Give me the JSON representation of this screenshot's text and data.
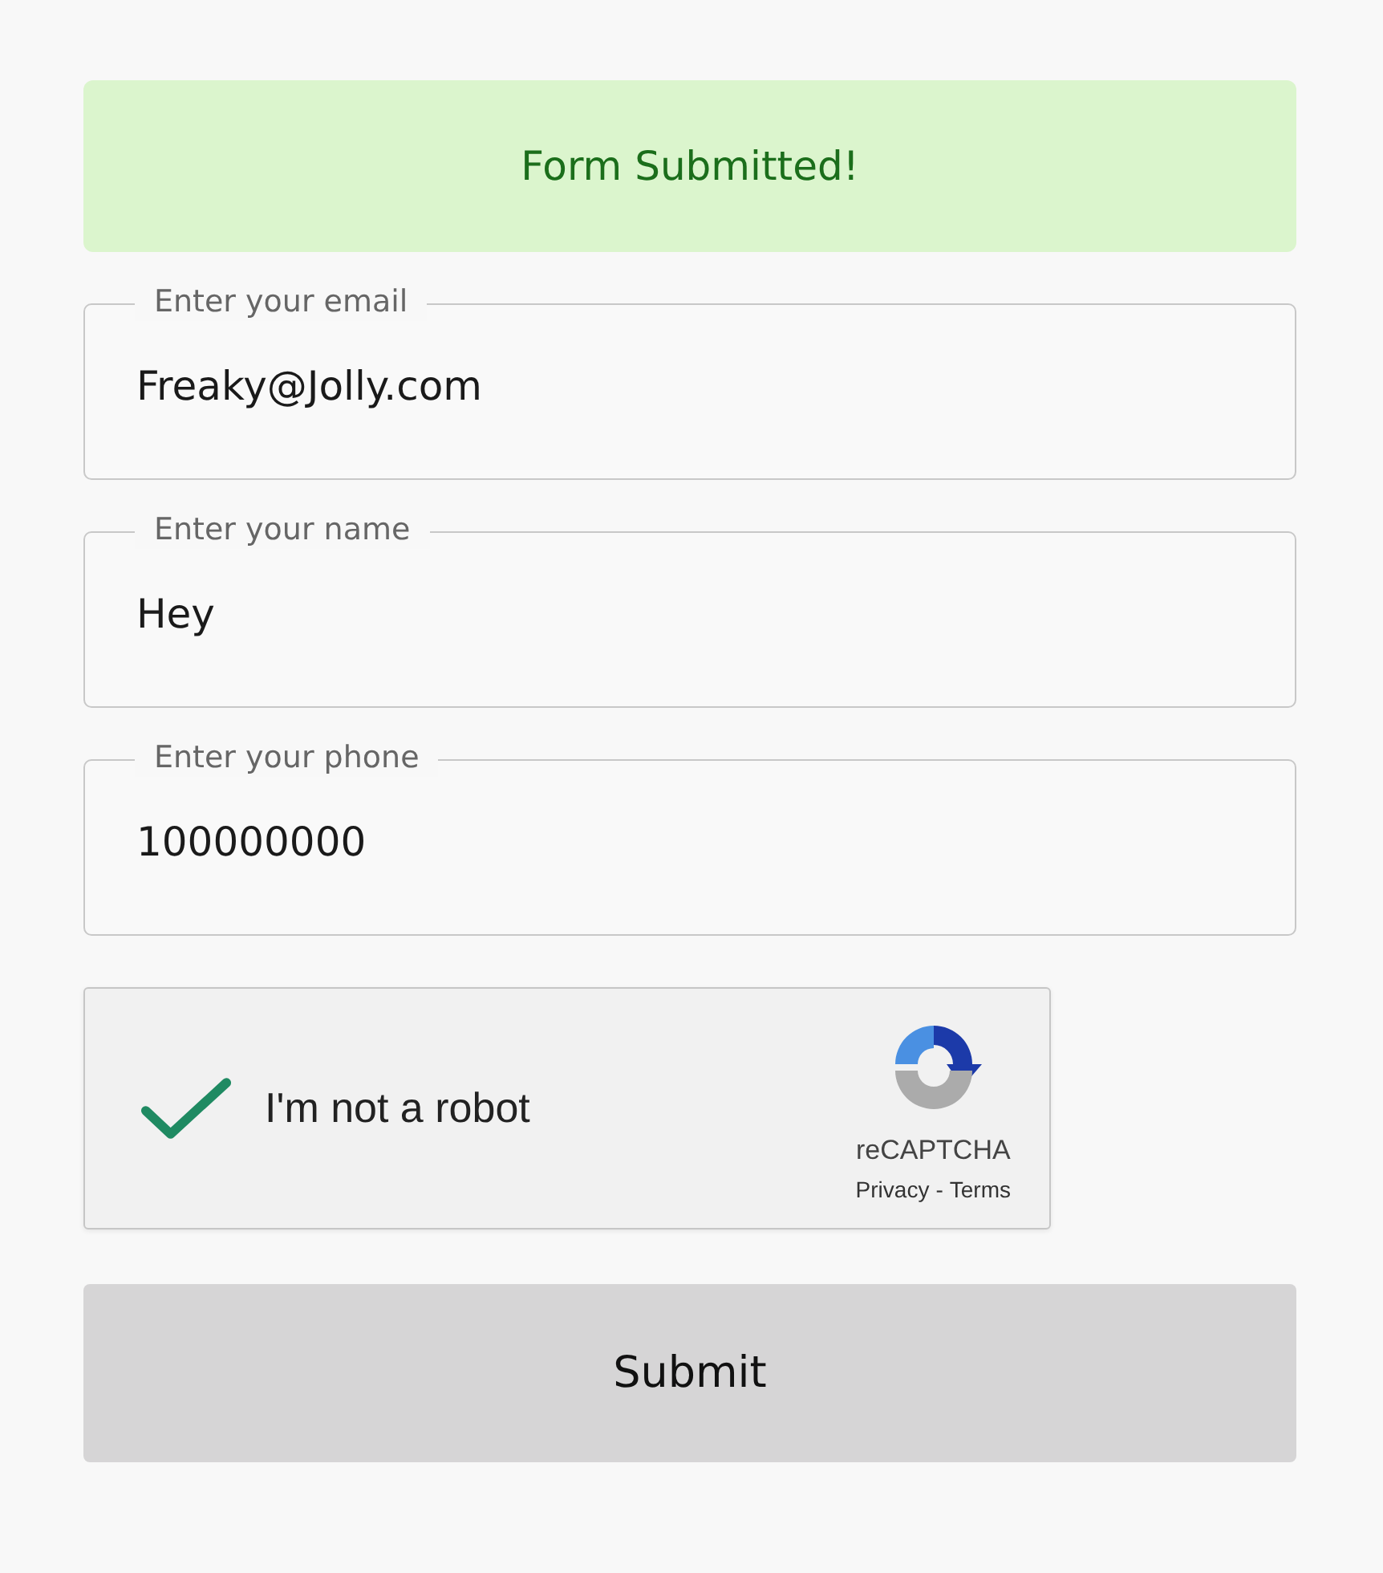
{
  "alert": {
    "message": "Form Submitted!"
  },
  "fields": [
    {
      "label": "Enter your email",
      "value": "Freaky@Jolly.com"
    },
    {
      "label": "Enter your name",
      "value": "Hey"
    },
    {
      "label": "Enter your phone",
      "value": "100000000"
    }
  ],
  "captcha": {
    "checked": true,
    "label": "I'm not a robot",
    "brand": "reCAPTCHA",
    "privacy": "Privacy",
    "separator": "-",
    "terms": "Terms"
  },
  "submit": "Submit"
}
